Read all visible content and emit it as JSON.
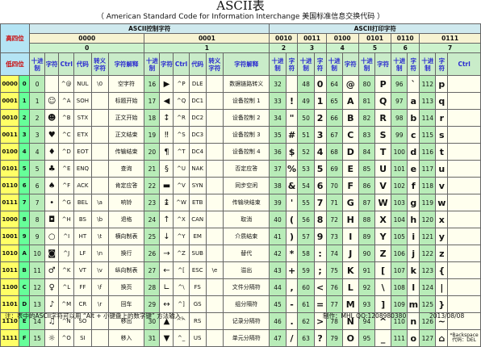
{
  "title": "ASCII表",
  "subtitle": "（ American Standard Code for Information Interchange  美国标准信息交换代码 ）",
  "header": {
    "high_label": "高四位",
    "low_label": "低四位",
    "control_section": "ASCII控制字符",
    "print_section": "ASCII打印字符",
    "groups": [
      "0000",
      "0001",
      "0010",
      "0011",
      "0100",
      "0101",
      "0110",
      "0111"
    ],
    "group_numbers": [
      "0",
      "1",
      "2",
      "3",
      "4",
      "5",
      "6",
      "7"
    ],
    "cols_control": [
      "十进制",
      "字符",
      "Ctrl",
      "代码",
      "转义字符",
      "字符解释"
    ],
    "cols_print_pair": [
      "十进制",
      "字符"
    ],
    "cols_last": [
      "十进制",
      "字符",
      "Ctrl"
    ]
  },
  "rows": [
    {
      "bits": "0000",
      "hex": "0",
      "c0": [
        "0",
        "",
        "^@",
        "NUL",
        "\\0",
        "空字符"
      ],
      "c1": [
        "16",
        "▶",
        "^P",
        "DLE",
        "",
        "数据链路转义"
      ],
      "p": [
        [
          "32",
          ""
        ],
        [
          "48",
          "0"
        ],
        [
          "64",
          "@"
        ],
        [
          "80",
          "P"
        ],
        [
          "96",
          "`"
        ],
        [
          "112",
          "p"
        ]
      ]
    },
    {
      "bits": "0001",
      "hex": "1",
      "c0": [
        "1",
        "☺",
        "^A",
        "SOH",
        "",
        "标题开始"
      ],
      "c1": [
        "17",
        "◀",
        "^Q",
        "DC1",
        "",
        "设备控制 1"
      ],
      "p": [
        [
          "33",
          "!"
        ],
        [
          "49",
          "1"
        ],
        [
          "65",
          "A"
        ],
        [
          "81",
          "Q"
        ],
        [
          "97",
          "a"
        ],
        [
          "113",
          "q"
        ]
      ]
    },
    {
      "bits": "0010",
      "hex": "2",
      "c0": [
        "2",
        "☻",
        "^B",
        "STX",
        "",
        "正文开始"
      ],
      "c1": [
        "18",
        "↕",
        "^R",
        "DC2",
        "",
        "设备控制 2"
      ],
      "p": [
        [
          "34",
          "\""
        ],
        [
          "50",
          "2"
        ],
        [
          "66",
          "B"
        ],
        [
          "82",
          "R"
        ],
        [
          "98",
          "b"
        ],
        [
          "114",
          "r"
        ]
      ]
    },
    {
      "bits": "0011",
      "hex": "3",
      "c0": [
        "3",
        "♥",
        "^C",
        "ETX",
        "",
        "正文结束"
      ],
      "c1": [
        "19",
        "‼",
        "^S",
        "DC3",
        "",
        "设备控制 3"
      ],
      "p": [
        [
          "35",
          "#"
        ],
        [
          "51",
          "3"
        ],
        [
          "67",
          "C"
        ],
        [
          "83",
          "S"
        ],
        [
          "99",
          "c"
        ],
        [
          "115",
          "s"
        ]
      ]
    },
    {
      "bits": "0100",
      "hex": "4",
      "c0": [
        "4",
        "♦",
        "^D",
        "EOT",
        "",
        "传输结束"
      ],
      "c1": [
        "20",
        "¶",
        "^T",
        "DC4",
        "",
        "设备控制 4"
      ],
      "p": [
        [
          "36",
          "$"
        ],
        [
          "52",
          "4"
        ],
        [
          "68",
          "D"
        ],
        [
          "84",
          "T"
        ],
        [
          "100",
          "d"
        ],
        [
          "116",
          "t"
        ]
      ]
    },
    {
      "bits": "0101",
      "hex": "5",
      "c0": [
        "5",
        "♣",
        "^E",
        "ENQ",
        "",
        "查询"
      ],
      "c1": [
        "21",
        "§",
        "^U",
        "NAK",
        "",
        "否定应答"
      ],
      "p": [
        [
          "37",
          "%"
        ],
        [
          "53",
          "5"
        ],
        [
          "69",
          "E"
        ],
        [
          "85",
          "U"
        ],
        [
          "101",
          "e"
        ],
        [
          "117",
          "u"
        ]
      ]
    },
    {
      "bits": "0110",
      "hex": "6",
      "c0": [
        "6",
        "♠",
        "^F",
        "ACK",
        "",
        "肯定应答"
      ],
      "c1": [
        "22",
        "▬",
        "^V",
        "SYN",
        "",
        "同步空闲"
      ],
      "p": [
        [
          "38",
          "&"
        ],
        [
          "54",
          "6"
        ],
        [
          "70",
          "F"
        ],
        [
          "86",
          "V"
        ],
        [
          "102",
          "f"
        ],
        [
          "118",
          "v"
        ]
      ]
    },
    {
      "bits": "0111",
      "hex": "7",
      "c0": [
        "7",
        "•",
        "^G",
        "BEL",
        "\\a",
        "响铃"
      ],
      "c1": [
        "23",
        "↨",
        "^W",
        "ETB",
        "",
        "传输块结束"
      ],
      "p": [
        [
          "39",
          "'"
        ],
        [
          "55",
          "7"
        ],
        [
          "71",
          "G"
        ],
        [
          "87",
          "W"
        ],
        [
          "103",
          "g"
        ],
        [
          "119",
          "w"
        ]
      ]
    },
    {
      "bits": "1000",
      "hex": "8",
      "c0": [
        "8",
        "◘",
        "^H",
        "BS",
        "\\b",
        "退格"
      ],
      "c1": [
        "24",
        "↑",
        "^X",
        "CAN",
        "",
        "取消"
      ],
      "p": [
        [
          "40",
          "("
        ],
        [
          "56",
          "8"
        ],
        [
          "72",
          "H"
        ],
        [
          "88",
          "X"
        ],
        [
          "104",
          "h"
        ],
        [
          "120",
          "x"
        ]
      ]
    },
    {
      "bits": "1001",
      "hex": "9",
      "c0": [
        "9",
        "○",
        "^I",
        "HT",
        "\\t",
        "横向制表"
      ],
      "c1": [
        "25",
        "↓",
        "^Y",
        "EM",
        "",
        "介质结束"
      ],
      "p": [
        [
          "41",
          ")"
        ],
        [
          "57",
          "9"
        ],
        [
          "73",
          "I"
        ],
        [
          "89",
          "Y"
        ],
        [
          "105",
          "i"
        ],
        [
          "121",
          "y"
        ]
      ]
    },
    {
      "bits": "1010",
      "hex": "A",
      "c0": [
        "10",
        "◙",
        "^J",
        "LF",
        "\\n",
        "换行"
      ],
      "c1": [
        "26",
        "→",
        "^Z",
        "SUB",
        "",
        "替代"
      ],
      "p": [
        [
          "42",
          "*"
        ],
        [
          "58",
          ":"
        ],
        [
          "74",
          "J"
        ],
        [
          "90",
          "Z"
        ],
        [
          "106",
          "j"
        ],
        [
          "122",
          "z"
        ]
      ]
    },
    {
      "bits": "1011",
      "hex": "B",
      "c0": [
        "11",
        "♂",
        "^K",
        "VT",
        "\\v",
        "纵向制表"
      ],
      "c1": [
        "27",
        "←",
        "^[",
        "ESC",
        "\\e",
        "溢出"
      ],
      "p": [
        [
          "43",
          "+"
        ],
        [
          "59",
          ";"
        ],
        [
          "75",
          "K"
        ],
        [
          "91",
          "["
        ],
        [
          "107",
          "k"
        ],
        [
          "123",
          "{"
        ]
      ]
    },
    {
      "bits": "1100",
      "hex": "C",
      "c0": [
        "12",
        "♀",
        "^L",
        "FF",
        "\\f",
        "换页"
      ],
      "c1": [
        "28",
        "∟",
        "^\\",
        "FS",
        "",
        "文件分隔符"
      ],
      "p": [
        [
          "44",
          ","
        ],
        [
          "60",
          "<"
        ],
        [
          "76",
          "L"
        ],
        [
          "92",
          "\\"
        ],
        [
          "108",
          "l"
        ],
        [
          "124",
          "|"
        ]
      ]
    },
    {
      "bits": "1101",
      "hex": "D",
      "c0": [
        "13",
        "♪",
        "^M",
        "CR",
        "\\r",
        "回车"
      ],
      "c1": [
        "29",
        "↔",
        "^]",
        "GS",
        "",
        "组分隔符"
      ],
      "p": [
        [
          "45",
          "-"
        ],
        [
          "61",
          "="
        ],
        [
          "77",
          "M"
        ],
        [
          "93",
          "]"
        ],
        [
          "109",
          "m"
        ],
        [
          "125",
          "}"
        ]
      ]
    },
    {
      "bits": "1110",
      "hex": "E",
      "c0": [
        "14",
        "♫",
        "^N",
        "SO",
        "",
        "移出"
      ],
      "c1": [
        "30",
        "▲",
        "^^",
        "RS",
        "",
        "记录分隔符"
      ],
      "p": [
        [
          "46",
          "."
        ],
        [
          "62",
          ">"
        ],
        [
          "78",
          "N"
        ],
        [
          "94",
          "^"
        ],
        [
          "110",
          "n"
        ],
        [
          "126",
          "~"
        ]
      ]
    },
    {
      "bits": "1111",
      "hex": "F",
      "c0": [
        "15",
        "☼",
        "^O",
        "SI",
        "",
        "移入"
      ],
      "c1": [
        "31",
        "▼",
        "^_",
        "US",
        "",
        "单元分隔符"
      ],
      "p": [
        [
          "47",
          "/"
        ],
        [
          "63",
          "?"
        ],
        [
          "79",
          "O"
        ],
        [
          "95",
          "_"
        ],
        [
          "111",
          "o"
        ],
        [
          "127",
          "⌂"
        ]
      ]
    }
  ],
  "last_ctrl": [
    "",
    "",
    "",
    "",
    "",
    "",
    "",
    "",
    "",
    "",
    "",
    "",
    "",
    "",
    "",
    "*Backspace 代码：DEL"
  ],
  "footer": {
    "note": "注：表中的ASCII字符可以用 “Alt + 小键盘上的数字键” 方法输入。",
    "author": "制作：MHL  QQ:1208980380",
    "date": "2013/08/08"
  }
}
